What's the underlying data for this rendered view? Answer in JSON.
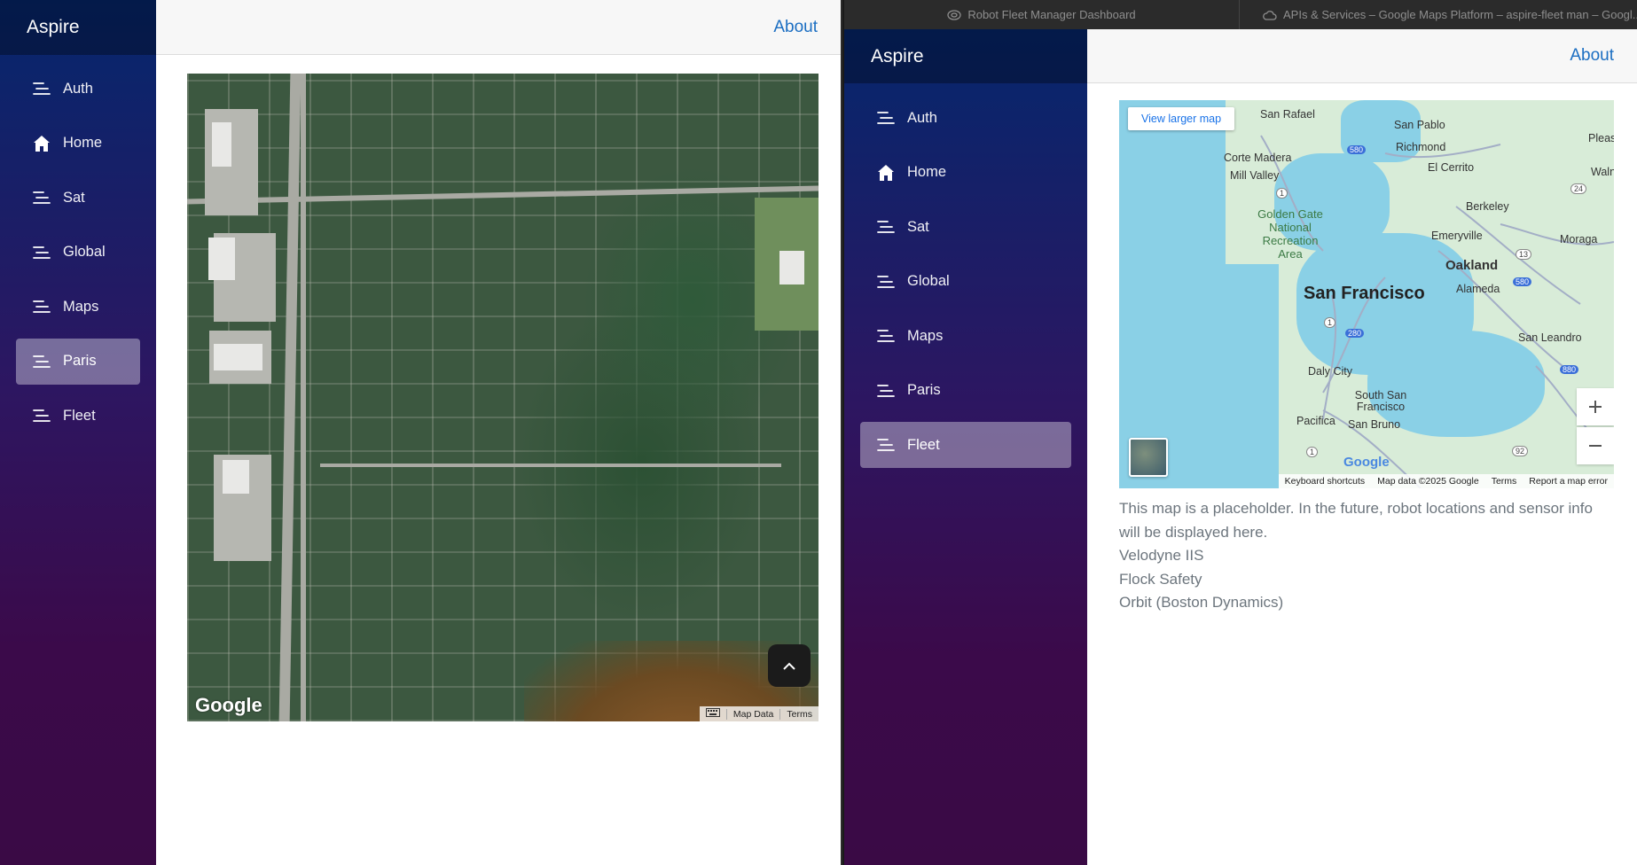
{
  "left_window": {
    "brand": "Aspire",
    "nav": [
      {
        "label": "Auth",
        "icon": "menu-lines-icon"
      },
      {
        "label": "Home",
        "icon": "home-icon"
      },
      {
        "label": "Sat",
        "icon": "menu-lines-icon"
      },
      {
        "label": "Global",
        "icon": "menu-lines-icon"
      },
      {
        "label": "Maps",
        "icon": "menu-lines-icon"
      },
      {
        "label": "Paris",
        "icon": "menu-lines-icon",
        "active": true
      },
      {
        "label": "Fleet",
        "icon": "menu-lines-icon"
      }
    ],
    "about": "About",
    "map": {
      "logo": "Google",
      "map_data": "Map Data",
      "terms": "Terms",
      "scroll_up_icon": "chevron-up-icon"
    }
  },
  "right_window": {
    "tabs": [
      {
        "title": "Robot Fleet Manager Dashboard",
        "icon": "robot-icon"
      },
      {
        "title": "APIs & Services – Google Maps Platform – aspire-fleet man – Googl...",
        "icon": "cloud-icon"
      }
    ],
    "brand": "Aspire",
    "nav": [
      {
        "label": "Auth",
        "icon": "menu-lines-icon"
      },
      {
        "label": "Home",
        "icon": "home-icon"
      },
      {
        "label": "Sat",
        "icon": "menu-lines-icon"
      },
      {
        "label": "Global",
        "icon": "menu-lines-icon"
      },
      {
        "label": "Maps",
        "icon": "menu-lines-icon"
      },
      {
        "label": "Paris",
        "icon": "menu-lines-icon"
      },
      {
        "label": "Fleet",
        "icon": "menu-lines-icon",
        "active": true
      }
    ],
    "about": "About",
    "map": {
      "view_larger": "View larger map",
      "zoom_in": "+",
      "zoom_out": "−",
      "logo": "Google",
      "keyboard_shortcuts": "Keyboard shortcuts",
      "map_data": "Map data ©2025 Google",
      "terms": "Terms",
      "report": "Report a map error",
      "places": {
        "san_francisco": "San Francisco",
        "san_rafael": "San Rafael",
        "san_pablo": "San Pablo",
        "richmond": "Richmond",
        "corte_madera": "Corte Madera",
        "el_cerrito": "El Cerrito",
        "mill_valley": "Mill Valley",
        "walnut": "Walnu",
        "pleasant": "Pleas",
        "berkeley": "Berkeley",
        "golden_gate": "Golden Gate National Recreation Area",
        "emeryville": "Emeryville",
        "moraga": "Moraga",
        "oakland": "Oakland",
        "alameda": "Alameda",
        "san_leandro": "San Leandro",
        "daly_city": "Daly City",
        "south_sf": "South San Francisco",
        "pacifica": "Pacifica",
        "san_bruno": "San Bruno"
      },
      "highways": [
        "580",
        "1",
        "24",
        "13",
        "580",
        "1",
        "280",
        "880",
        "1",
        "92",
        "280"
      ]
    },
    "info_lines": [
      "This map is a placeholder. In the future, robot locations and sensor info will be displayed here.",
      "Velodyne IIS",
      "Flock Safety",
      "Orbit (Boston Dynamics)"
    ]
  },
  "colors": {
    "sidebar_top": "#05276d",
    "sidebar_bottom": "#3a0a45",
    "active_item": "rgba(255,255,255,0.37)",
    "link": "#1b6ec2",
    "muted_text": "#6c757d"
  }
}
